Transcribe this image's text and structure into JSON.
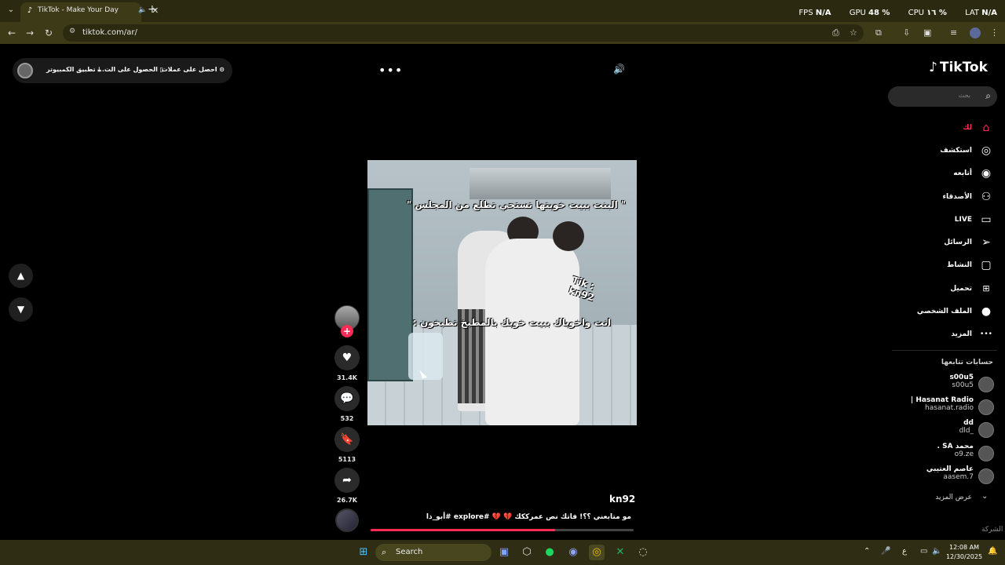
{
  "browser": {
    "tab_title": "TikTok - Make Your Day",
    "tab_close": "✕",
    "new_tab": "+",
    "url": "tiktok.com/ar/",
    "hud": {
      "fps_label": "FPS",
      "fps_value": "N/A",
      "gpu_label": "GPU",
      "gpu_value": "48 %",
      "cpu_label": "CPU",
      "cpu_value": "١٦ %",
      "lat_label": "LAT",
      "lat_value": "N/A"
    }
  },
  "topbar": {
    "get_coins": "احصل على عملات",
    "get_app": "الحصول على الت...",
    "desktop_app": "تطبيق الكمبيوتر",
    "more": "•••"
  },
  "video": {
    "caption_top": "\" البنت ببيت خويتها تستحي تطلع من المجلس \"",
    "caption_mid": "انت واخوياك ببيت خويك بالمطبخ تطبخون :",
    "watermark_1": "Tik :",
    "watermark_2": "kn92",
    "username": "kn92",
    "description": "مو متابعني ؟؟! فاتك نص عمرككك 💔 💔 #explore #أبو_ذا",
    "progress": 0.7
  },
  "actions": {
    "likes": "31.4K",
    "comments": "532",
    "saves": "5113",
    "shares": "26.7K"
  },
  "sidebar": {
    "logo": "TikTok",
    "search_placeholder": "بحث",
    "nav": [
      {
        "label": "لك",
        "active": true
      },
      {
        "label": "استكشف"
      },
      {
        "label": "أتابعه"
      },
      {
        "label": "الأصدقاء"
      },
      {
        "label": "LIVE"
      },
      {
        "label": "الرسائل"
      },
      {
        "label": "النشاط"
      },
      {
        "label": "تحميل"
      },
      {
        "label": "الملف الشخصي"
      },
      {
        "label": "المزيد"
      }
    ],
    "following_heading": "حسابات تتابعها",
    "following": [
      {
        "name": "s00u5",
        "handle": "s00u5"
      },
      {
        "name": "Hasanat Radio |",
        "handle": "hasanat.radio"
      },
      {
        "name": "dd",
        "handle": "_dld"
      },
      {
        "name": "محمد SA .",
        "handle": "o9.ze"
      },
      {
        "name": "عاصم العتيبي",
        "handle": "aasem.7"
      }
    ],
    "see_more": "عرض المزيد",
    "company": "الشركة"
  },
  "taskbar": {
    "search_label": "Search",
    "lang": "ع",
    "time": "12:08 AM",
    "date": "12/30/2025"
  },
  "colors": {
    "accent": "#fe2c55",
    "chrome_bg": "#3d3a17",
    "taskbar_bg": "#2f2d13"
  }
}
